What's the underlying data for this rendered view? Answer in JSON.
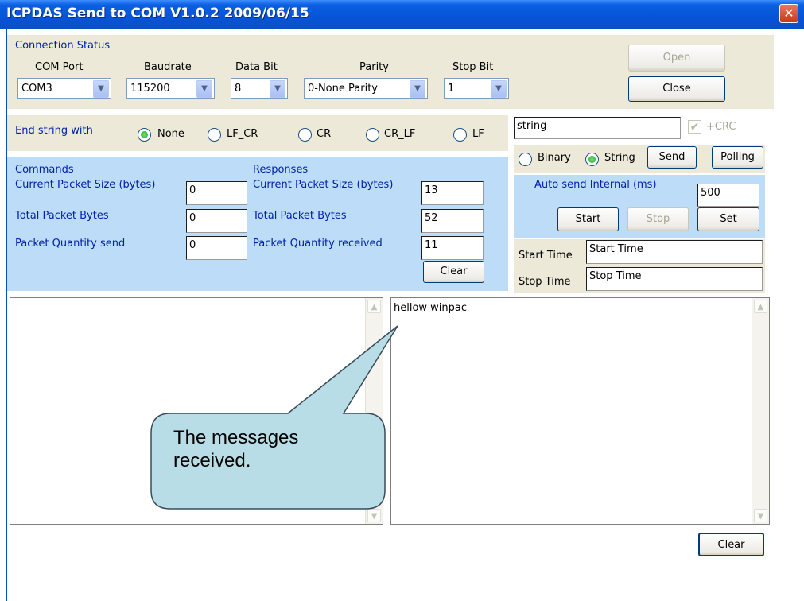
{
  "window": {
    "title": "ICPDAS Send to COM V1.0.2  2009/06/15",
    "close_glyph": "✕"
  },
  "connection": {
    "group_label": "Connection Status",
    "com_port": {
      "label": "COM Port",
      "value": "COM3"
    },
    "baudrate": {
      "label": "Baudrate",
      "value": "115200"
    },
    "data_bit": {
      "label": "Data Bit",
      "value": "8"
    },
    "parity": {
      "label": "Parity",
      "value": "0-None Parity"
    },
    "stop_bit": {
      "label": "Stop Bit",
      "value": "1"
    },
    "open_label": "Open",
    "close_label": "Close"
  },
  "end_string": {
    "label": "End string with",
    "options": [
      "None",
      "LF_CR",
      "CR",
      "CR_LF",
      "LF"
    ],
    "selected": "None"
  },
  "send": {
    "string_value": "string",
    "crc_label": "+CRC",
    "crc_checked": true,
    "binary_label": "Binary",
    "string_label": "String",
    "mode_selected": "String",
    "send_label": "Send",
    "polling_label": "Polling"
  },
  "auto_send": {
    "label": "Auto send Internal (ms)",
    "value": "500",
    "start_label": "Start",
    "stop_label": "Stop",
    "set_label": "Set"
  },
  "commands": {
    "header": "Commands",
    "current_packet_label": "Current Packet Size (bytes)",
    "current_packet_value": "0",
    "total_bytes_label": "Total Packet Bytes",
    "total_bytes_value": "0",
    "quantity_label": "Packet Quantity send",
    "quantity_value": "0"
  },
  "responses": {
    "header": "Responses",
    "current_packet_label": "Current Packet Size (bytes)",
    "current_packet_value": "13",
    "total_bytes_label": "Total Packet Bytes",
    "total_bytes_value": "52",
    "quantity_label": "Packet Quantity received",
    "quantity_value": "11",
    "clear_label": "Clear"
  },
  "times": {
    "start_label": "Start Time",
    "start_value": "Start Time",
    "stop_label": "Stop Time",
    "stop_value": "Stop Time"
  },
  "received": {
    "text": "hellow winpac",
    "clear_label": "Clear"
  },
  "callout": {
    "text": "The messages received."
  },
  "colors": {
    "title_bar": "#0654d8",
    "panel": "#ece9d8",
    "blue_panel": "#bcdcf8",
    "label_blue": "#0022aa",
    "callout_fill": "#b8dde6"
  }
}
